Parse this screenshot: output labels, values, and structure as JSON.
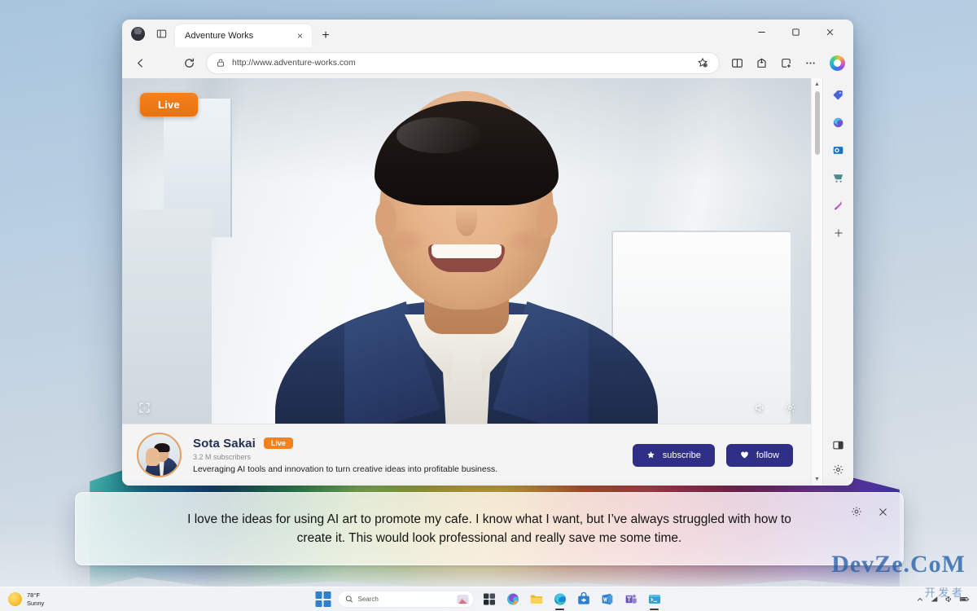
{
  "browser": {
    "tab": {
      "title": "Adventure Works",
      "close_label": "×"
    },
    "new_tab_label": "+",
    "url": "http://www.adventure-works.com",
    "window_controls": {
      "minimize": "–",
      "maximize": "□",
      "close": "×"
    },
    "toolbar_icons": [
      "profile-avatar",
      "tab-actions",
      "back",
      "refresh",
      "lock",
      "favorite",
      "split-screen",
      "collections",
      "add-to-favorites",
      "more-options",
      "copilot"
    ],
    "rail_icons": [
      "tag",
      "edge-shopping",
      "outlook",
      "shopping-cart",
      "drawing",
      "add",
      "split-pane",
      "settings"
    ]
  },
  "page": {
    "live_badge": "Live",
    "controls": {
      "fullscreen": "fullscreen-icon",
      "volume": "volume-icon",
      "settings": "settings-gear-icon"
    },
    "channel": {
      "name": "Sota Sakai",
      "live_tag": "Live",
      "subscribers": "3.2 M subscribers",
      "description": "Leveraging AI tools and innovation to turn creative ideas into profitable business.",
      "subscribe_label": "subscribe",
      "follow_label": "follow"
    }
  },
  "caption": {
    "text": "I love the ideas for using AI art to promote my cafe. I know what I want, but I’ve always struggled with how to create it. This would look professional and really save me some time.",
    "settings_label": "settings-gear-icon",
    "close_label": "×"
  },
  "taskbar": {
    "weather": {
      "temperature": "78°F",
      "condition": "Sunny"
    },
    "search_placeholder": "Search",
    "apps": [
      "start",
      "search",
      "widgets",
      "copilot",
      "file-explorer",
      "edge",
      "store",
      "word",
      "teams",
      "terminal"
    ]
  },
  "watermark": {
    "line1": "开 发 者",
    "line2": "DevZe.CoM"
  },
  "colors": {
    "accent_orange": "#f5821f",
    "button_indigo": "#2f2f86",
    "channel_name": "#232f55"
  }
}
